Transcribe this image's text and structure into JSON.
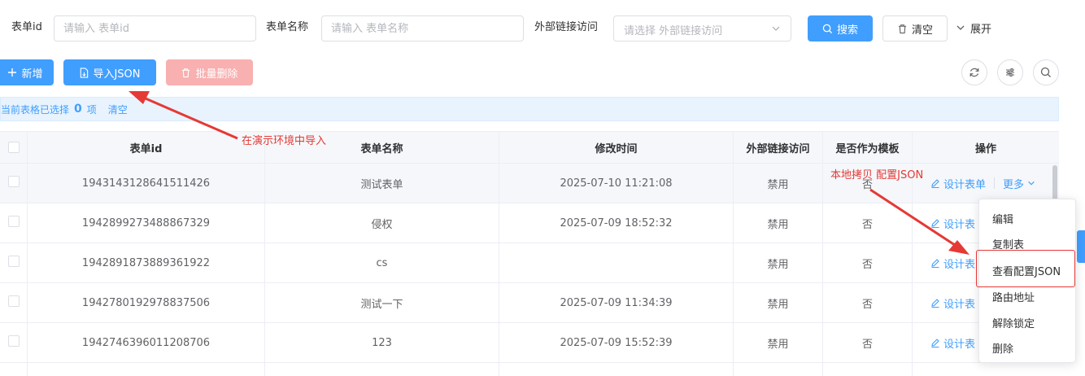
{
  "search": {
    "form_id_label": "表单id",
    "form_id_placeholder": "请输入 表单id",
    "form_name_label": "表单名称",
    "form_name_placeholder": "请输入 表单名称",
    "external_label": "外部链接访问",
    "external_placeholder": "请选择 外部链接访问",
    "search_button": "搜索",
    "clear_button": "清空",
    "expand_label": "展开"
  },
  "toolbar": {
    "add_button": "新增",
    "import_button": "导入JSON",
    "batch_delete_button": "批量删除"
  },
  "selection": {
    "prefix": "当前表格已选择",
    "count": "0",
    "suffix": "项",
    "clear": "清空"
  },
  "table": {
    "headers": [
      "表单id",
      "表单名称",
      "修改时间",
      "外部链接访问",
      "是否作为模板",
      "操作"
    ],
    "design_label": "设计表单",
    "design_label_short": "设计表",
    "more_label": "更多",
    "rows": [
      {
        "id": "1943143128641511426",
        "name": "测试表单",
        "modified": "2025-07-10 11:21:08",
        "external": "禁用",
        "template": "否"
      },
      {
        "id": "1942899273488867329",
        "name": "侵权",
        "modified": "2025-07-09 18:52:32",
        "external": "禁用",
        "template": "否"
      },
      {
        "id": "1942891873889361922",
        "name": "cs",
        "modified": "",
        "external": "禁用",
        "template": "否"
      },
      {
        "id": "1942780192978837506",
        "name": "测试一下",
        "modified": "2025-07-09 11:34:39",
        "external": "禁用",
        "template": "否"
      },
      {
        "id": "1942746396011208706",
        "name": "123",
        "modified": "2025-07-09 15:52:39",
        "external": "禁用",
        "template": "否"
      }
    ]
  },
  "dropdown": {
    "items": [
      "编辑",
      "复制表",
      "查看配置JSON",
      "路由地址",
      "解除锁定",
      "删除"
    ]
  },
  "annotations": {
    "import_note": "在演示环境中导入",
    "copy_note": "本地拷贝 配置JSON"
  },
  "colors": {
    "primary": "#409eff",
    "annotation": "#e53935"
  }
}
